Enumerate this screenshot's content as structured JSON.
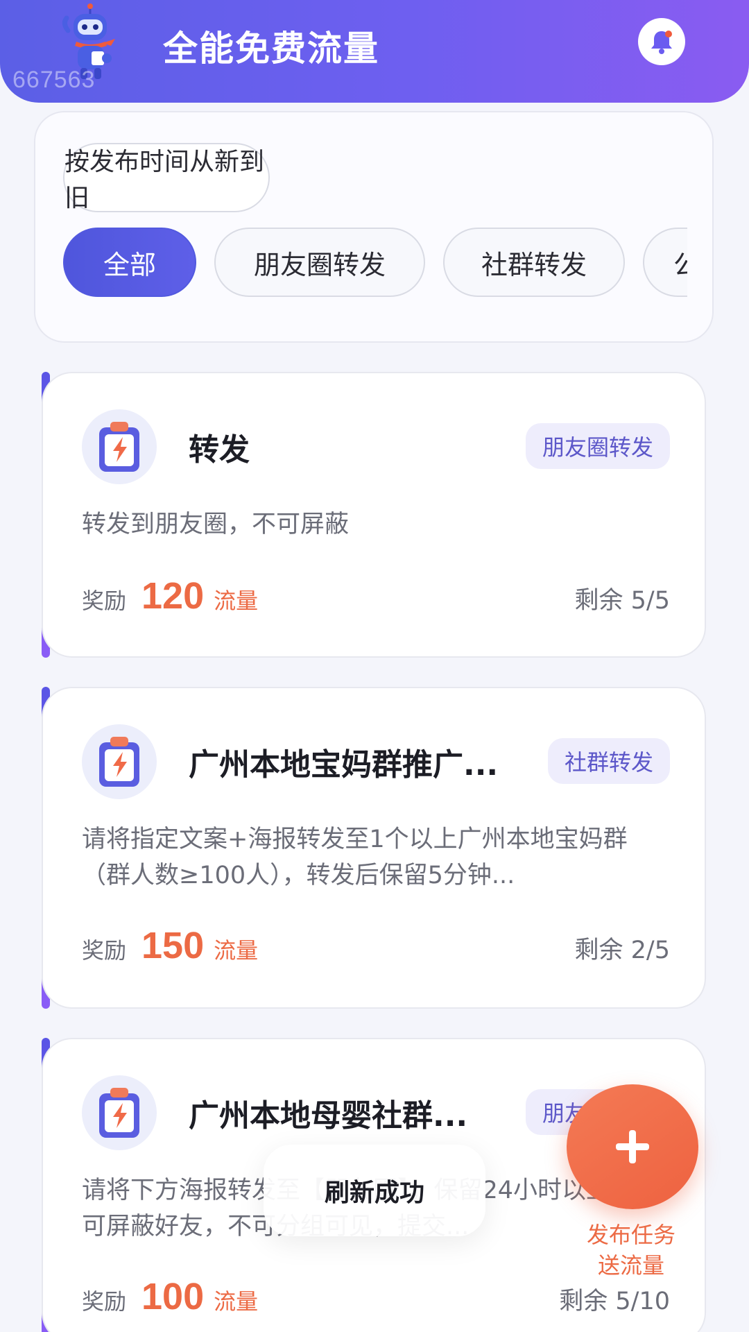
{
  "header": {
    "watermark": "667563",
    "title": "全能免费流量"
  },
  "filters": {
    "sort_label": "按发布时间从新到旧",
    "tabs": [
      "全部",
      "朋友圈转发",
      "社群转发",
      "公"
    ]
  },
  "tasks": [
    {
      "title": "转发",
      "tag": "朋友圈转发",
      "desc": "转发到朋友圈，不可屏蔽",
      "reward_label": "奖励",
      "reward_value": "120",
      "reward_unit": "流量",
      "remaining": "剩余 5/5"
    },
    {
      "title": "广州本地宝妈群推广...",
      "tag": "社群转发",
      "desc": "请将指定文案+海报转发至1个以上广州本地宝妈群（群人数≥100人），转发后保留5分钟...",
      "reward_label": "奖励",
      "reward_value": "150",
      "reward_unit": "流量",
      "remaining": "剩余 2/5"
    },
    {
      "title": "广州本地母婴社群...",
      "tag": "朋友圈转发",
      "desc": "请将下方海报转发至【朋友圈】，保留24小时以上，不可屏蔽好友，不可分组可见，提交...",
      "reward_label": "奖励",
      "reward_value": "100",
      "reward_unit": "流量",
      "remaining": "剩余 5/10"
    }
  ],
  "toast": "刷新成功",
  "fab": {
    "label_line1": "发布任务",
    "label_line2": "送流量"
  },
  "colors": {
    "brand": "#5b5fe6",
    "reward": "#ec6a44",
    "tag_text": "#5c57c9"
  }
}
